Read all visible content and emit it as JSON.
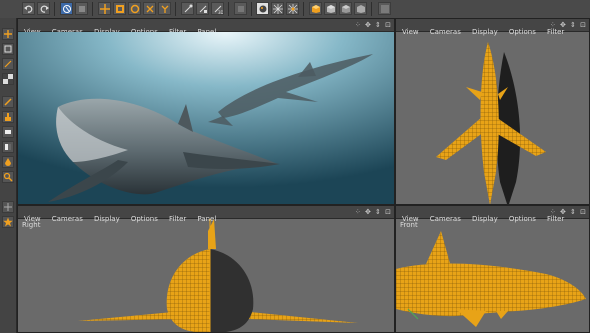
{
  "viewport_menu": [
    "View",
    "Cameras",
    "Display",
    "Options",
    "Filter",
    "Panel"
  ],
  "viewport_menu_short": [
    "View",
    "Cameras",
    "Display",
    "Options",
    "Filter"
  ],
  "nav_glyphs": "⁘ ✥ ⇕ ⊡",
  "viewports": {
    "main": {
      "label": ""
    },
    "top_right": {
      "label": ""
    },
    "bottom_left": {
      "label": "Right"
    },
    "bottom_right": {
      "label": "Front"
    }
  },
  "colors": {
    "wire": "#e8a317",
    "wire_dark": "#b57a10",
    "accent_orange": "#f0a020",
    "ocean_deep": "#1e4a5a",
    "ocean_light": "#9cc4d0"
  },
  "toolbar_icons": [
    "undo-icon",
    "redo-icon",
    "live-selection-icon",
    "move-icon",
    "scale-icon",
    "rotate-icon",
    "coord-x-icon",
    "coord-y-icon",
    "coord-z-icon",
    "world-coord-icon",
    "render-view-icon",
    "render-picture-viewer-icon",
    "render-settings-icon",
    "objects-mode-icon",
    "points-mode-icon",
    "edges-mode-icon",
    "polygons-mode-icon",
    "cube-icon",
    "spline-icon",
    "nurbs-icon",
    "deformer-icon",
    "scene-icon",
    "light-icon"
  ]
}
